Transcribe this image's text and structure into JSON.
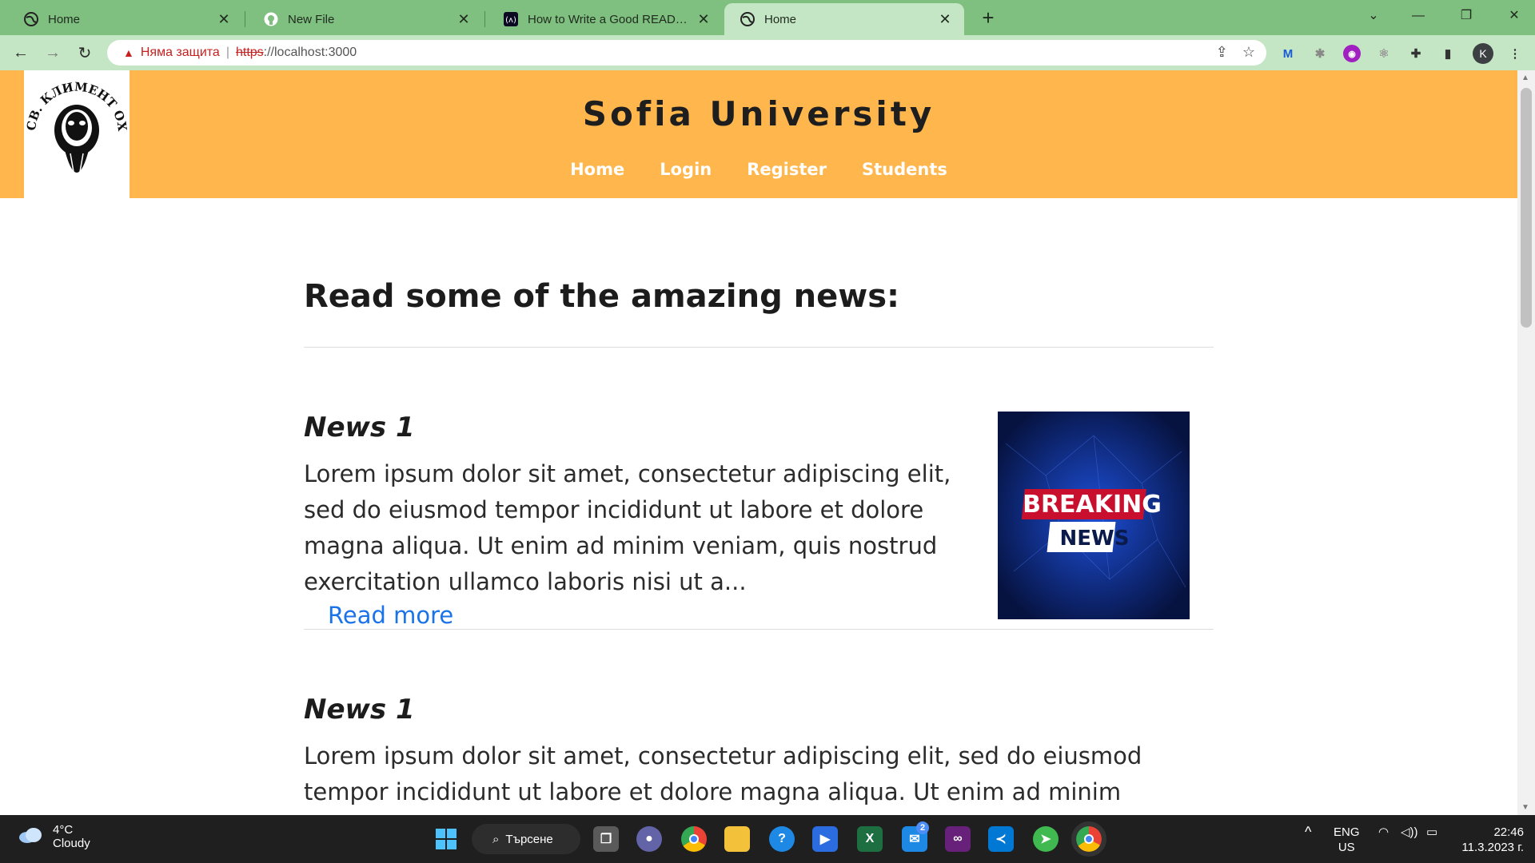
{
  "browser": {
    "tabs": [
      {
        "title": "Home",
        "active": false
      },
      {
        "title": "New File",
        "active": false
      },
      {
        "title": "How to Write a Good README File",
        "active": false
      },
      {
        "title": "Home",
        "active": true
      }
    ],
    "new_tab": "+",
    "security_label": "Няма защита",
    "url_scheme": "https",
    "url_rest": "://localhost:3000",
    "profile_initial": "K"
  },
  "site": {
    "logo_text": "СВ. КЛИМЕНТ ОХРИДСКИ",
    "title": "Sofia University",
    "nav": [
      "Home",
      "Login",
      "Register",
      "Students"
    ]
  },
  "main": {
    "heading": "Read some of the amazing news:",
    "news": [
      {
        "title": "News 1",
        "body": "Lorem ipsum dolor sit amet, consectetur adipiscing elit, sed do eiusmod tempor incididunt ut labore et dolore magna aliqua. Ut enim ad minim veniam, quis nostrud exercitation ullamco laboris nisi ut a...",
        "read_more": "Read more",
        "image_text_1": "BREAKING",
        "image_text_2": "NEWS"
      },
      {
        "title": "News 1",
        "body": "Lorem ipsum dolor sit amet, consectetur adipiscing elit, sed do eiusmod tempor incididunt ut labore et dolore magna aliqua. Ut enim ad minim"
      }
    ]
  },
  "taskbar": {
    "weather_temp": "4°C",
    "weather_desc": "Cloudy",
    "search_label": "Търсене",
    "mail_badge": "2",
    "lang_1": "ENG",
    "lang_2": "US",
    "time": "22:46",
    "date": "11.3.2023 г."
  },
  "colors": {
    "header": "#ffb74d",
    "tabbar": "#7fbf7f",
    "toolbar": "#c4e6c4",
    "link": "#1a73e8"
  }
}
